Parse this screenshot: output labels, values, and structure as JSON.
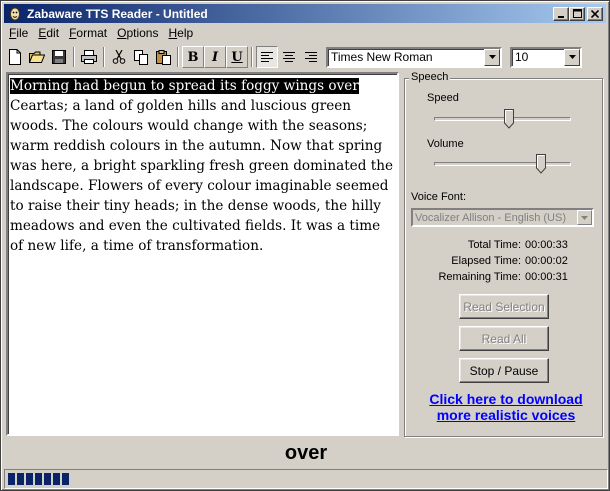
{
  "window": {
    "title": "Zabaware TTS Reader - Untitled"
  },
  "menu": [
    "File",
    "Edit",
    "Format",
    "Options",
    "Help"
  ],
  "menu_mnemonic": [
    "F",
    "E",
    "F",
    "O",
    "H"
  ],
  "toolbar": {
    "font_name": "Times New Roman",
    "font_size": "10",
    "bold_label": "B",
    "italic_label": "I",
    "underline_label": "U"
  },
  "editor": {
    "selected_text": "Morning had begun to spread its foggy wings over",
    "body_text": "Ceartas; a land of golden hills and luscious green woods. The colours would change with the seasons; warm reddish colours in the autumn. Now that spring was here, a bright sparkling fresh green dominated the landscape. Flowers of every colour imaginable seemed to raise their tiny heads; in the dense woods, the hilly meadows and even the cultivated fields. It was a time of new life, a time of transformation."
  },
  "speech": {
    "group_label": "Speech",
    "speed_label": "Speed",
    "volume_label": "Volume",
    "speed_level": 0.55,
    "volume_level": 0.78,
    "voice_font_label": "Voice Font:",
    "voice_font_value": "Vocalizer Allison - English (US)",
    "total_time_label": "Total Time:",
    "total_time": "00:00:33",
    "elapsed_time_label": "Elapsed Time:",
    "elapsed_time": "00:00:02",
    "remaining_time_label": "Remaining Time:",
    "remaining_time": "00:00:31",
    "read_selection_label": "Read Selection",
    "read_all_label": "Read All",
    "stop_pause_label": "Stop / Pause",
    "download_link_line1": "Click here to download",
    "download_link_line2": "more realistic voices"
  },
  "current_word": "over",
  "progress": {
    "blocks": 7
  },
  "colors": {
    "titlebar_start": "#0a246a",
    "titlebar_end": "#a6caf0",
    "face": "#d4d0c8",
    "link": "#0000ff",
    "progress": "#0a246a"
  }
}
